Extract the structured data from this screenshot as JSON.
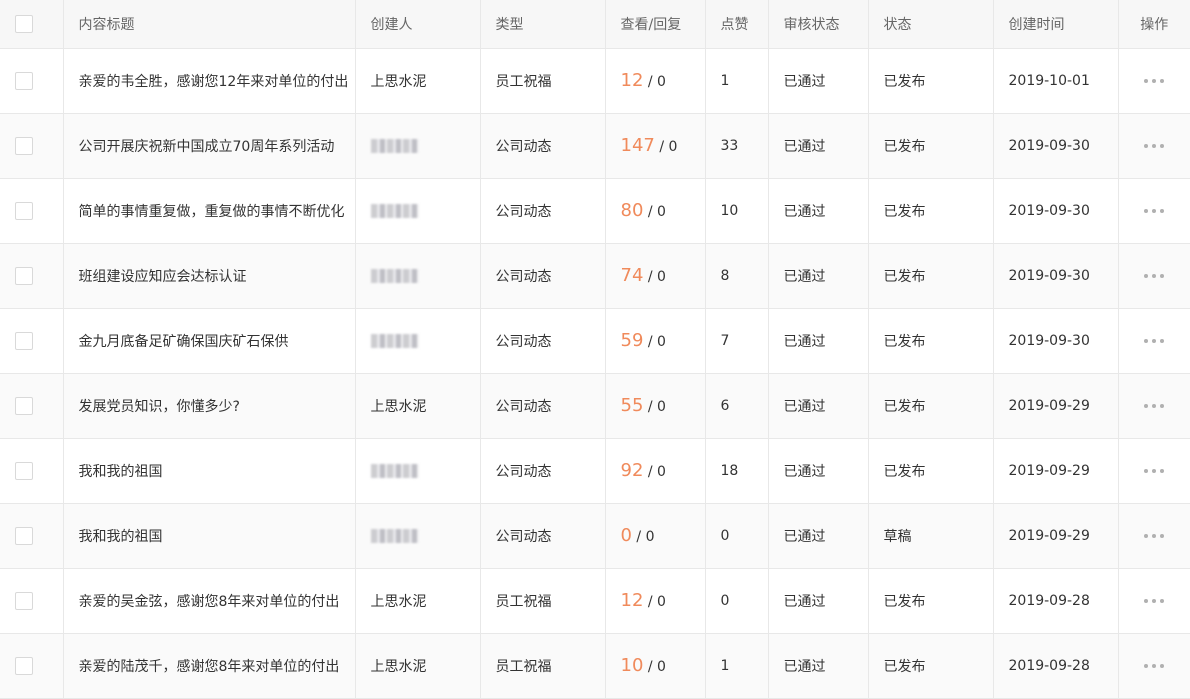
{
  "columns": {
    "title": "内容标题",
    "creator": "创建人",
    "type": "类型",
    "views_replies": "查看/回复",
    "likes": "点赞",
    "review_status": "审核状态",
    "status": "状态",
    "created_at": "创建时间",
    "actions": "操作"
  },
  "rows": [
    {
      "title": "亲爱的韦全胜，感谢您12年来对单位的付出",
      "creator": "上思水泥",
      "creator_blurred": false,
      "type": "员工祝福",
      "views": "12",
      "replies": "0",
      "likes": "1",
      "review_status": "已通过",
      "status": "已发布",
      "created_at": "2019-10-01"
    },
    {
      "title": "公司开展庆祝新中国成立70周年系列活动",
      "creator": "",
      "creator_blurred": true,
      "type": "公司动态",
      "views": "147",
      "replies": "0",
      "likes": "33",
      "review_status": "已通过",
      "status": "已发布",
      "created_at": "2019-09-30"
    },
    {
      "title": "简单的事情重复做，重复做的事情不断优化",
      "creator": "",
      "creator_blurred": true,
      "type": "公司动态",
      "views": "80",
      "replies": "0",
      "likes": "10",
      "review_status": "已通过",
      "status": "已发布",
      "created_at": "2019-09-30"
    },
    {
      "title": "班组建设应知应会达标认证",
      "creator": "",
      "creator_blurred": true,
      "type": "公司动态",
      "views": "74",
      "replies": "0",
      "likes": "8",
      "review_status": "已通过",
      "status": "已发布",
      "created_at": "2019-09-30"
    },
    {
      "title": "金九月底备足矿确保国庆矿石保供",
      "creator": "",
      "creator_blurred": true,
      "type": "公司动态",
      "views": "59",
      "replies": "0",
      "likes": "7",
      "review_status": "已通过",
      "status": "已发布",
      "created_at": "2019-09-30"
    },
    {
      "title": "发展党员知识，你懂多少?",
      "creator": "上思水泥",
      "creator_blurred": false,
      "type": "公司动态",
      "views": "55",
      "replies": "0",
      "likes": "6",
      "review_status": "已通过",
      "status": "已发布",
      "created_at": "2019-09-29"
    },
    {
      "title": "我和我的祖国",
      "creator": "",
      "creator_blurred": true,
      "type": "公司动态",
      "views": "92",
      "replies": "0",
      "likes": "18",
      "review_status": "已通过",
      "status": "已发布",
      "created_at": "2019-09-29"
    },
    {
      "title": "我和我的祖国",
      "creator": "",
      "creator_blurred": true,
      "type": "公司动态",
      "views": "0",
      "replies": "0",
      "likes": "0",
      "review_status": "已通过",
      "status": "草稿",
      "created_at": "2019-09-29"
    },
    {
      "title": "亲爱的吴金弦，感谢您8年来对单位的付出",
      "creator": "上思水泥",
      "creator_blurred": false,
      "type": "员工祝福",
      "views": "12",
      "replies": "0",
      "likes": "0",
      "review_status": "已通过",
      "status": "已发布",
      "created_at": "2019-09-28"
    },
    {
      "title": "亲爱的陆茂千，感谢您8年来对单位的付出",
      "creator": "上思水泥",
      "creator_blurred": false,
      "type": "员工祝福",
      "views": "10",
      "replies": "0",
      "likes": "1",
      "review_status": "已通过",
      "status": "已发布",
      "created_at": "2019-09-28"
    }
  ],
  "colors": {
    "views_accent": "#f08a5b",
    "header_bg": "#f7f7f7",
    "border": "#e8e8e8",
    "row_alt_bg": "#fafafa"
  },
  "icons": {
    "row_action": "more-horizontal-icon"
  }
}
